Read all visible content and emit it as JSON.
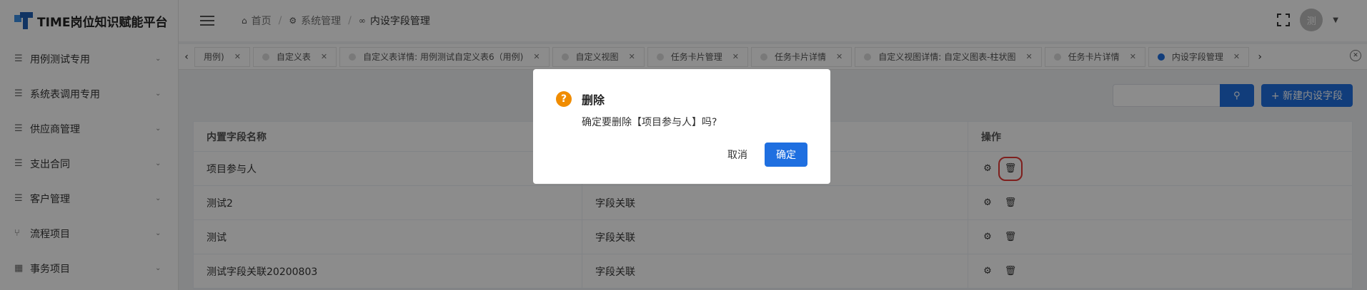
{
  "app": {
    "title": "TIME岗位知识赋能平台"
  },
  "sidebar": {
    "items": [
      {
        "label": "用例测试专用",
        "icon": "list-icon"
      },
      {
        "label": "系统表调用专用",
        "icon": "list-icon"
      },
      {
        "label": "供应商管理",
        "icon": "list-icon"
      },
      {
        "label": "支出合同",
        "icon": "list-icon"
      },
      {
        "label": "客户管理",
        "icon": "list-icon"
      },
      {
        "label": "流程项目",
        "icon": "branch-icon"
      },
      {
        "label": "事务项目",
        "icon": "grid-icon"
      }
    ]
  },
  "header": {
    "breadcrumb": [
      {
        "label": "首页",
        "icon": "home-icon"
      },
      {
        "label": "系统管理",
        "icon": "gear-icon"
      },
      {
        "label": "内设字段管理",
        "icon": "link-icon"
      }
    ],
    "avatar_text": "测"
  },
  "tabs": [
    {
      "label": "用例)",
      "active": false,
      "dot": false
    },
    {
      "label": "自定义表",
      "active": false,
      "dot": true
    },
    {
      "label": "自定义表详情: 用例测试自定义表6（用例)",
      "active": false,
      "dot": true
    },
    {
      "label": "自定义视图",
      "active": false,
      "dot": true
    },
    {
      "label": "任务卡片管理",
      "active": false,
      "dot": true
    },
    {
      "label": "任务卡片详情",
      "active": false,
      "dot": true
    },
    {
      "label": "自定义视图详情: 自定义图表-柱状图",
      "active": false,
      "dot": true
    },
    {
      "label": "任务卡片详情",
      "active": false,
      "dot": true
    },
    {
      "label": "内设字段管理",
      "active": true,
      "dot": true
    }
  ],
  "toolbar": {
    "search_placeholder": "",
    "new_label": "+ 新建内设字段"
  },
  "table": {
    "headers": [
      "内置字段名称",
      "",
      "操作"
    ],
    "rows": [
      {
        "name": "项目参与人",
        "type": ""
      },
      {
        "name": "测试2",
        "type": "字段关联"
      },
      {
        "name": "测试",
        "type": "字段关联"
      },
      {
        "name": "测试字段关联20200803",
        "type": "字段关联"
      }
    ]
  },
  "modal": {
    "title": "删除",
    "message": "确定要删除【项目参与人】吗?",
    "cancel_label": "取消",
    "ok_label": "确定"
  },
  "colors": {
    "primary": "#1f6fe0",
    "warning": "#f08c00",
    "highlight": "#e53935"
  }
}
